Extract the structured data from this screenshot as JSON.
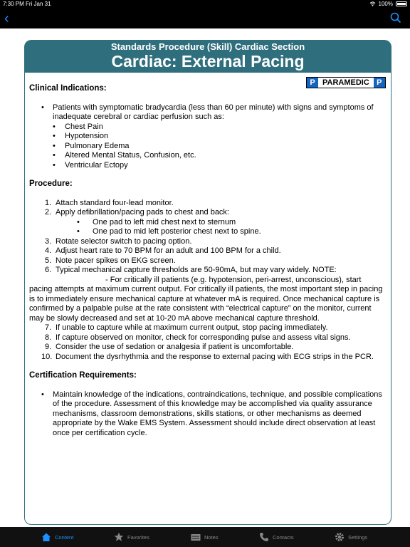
{
  "status": {
    "time": "7:30 PM",
    "date": "Fri Jan 31",
    "battery": "100%"
  },
  "header": {
    "subtitle": "Standards Procedure (Skill) Cardiac Section",
    "title": "Cardiac:  External Pacing"
  },
  "badge": {
    "left": "P",
    "label": "PARAMEDIC",
    "right": "P"
  },
  "clinical": {
    "heading": "Clinical Indications:",
    "main": "Patients with symptomatic bradycardia (less than 60 per minute) with signs and symptoms of inadequate cerebral or cardiac perfusion such as:",
    "items": [
      "Chest Pain",
      "Hypotension",
      "Pulmonary Edema",
      "Altered Mental Status, Confusion, etc.",
      "Ventricular Ectopy"
    ]
  },
  "procedure": {
    "heading": "Procedure:",
    "s1": "Attach standard four-lead monitor.",
    "s2": "Apply defibrillation/pacing pads to chest and back:",
    "s2a": "One pad to left mid chest next to sternum",
    "s2b": "One pad to mid left posterior chest next to spine.",
    "s3": "Rotate selector switch to pacing option.",
    "s4": "Adjust heart rate to 70 BPM for an adult and 100 BPM for a child.",
    "s5": "Note pacer spikes on EKG screen.",
    "s6": "Typical mechanical capture thresholds are 50-90mA, but may vary widely. NOTE:",
    "s6note": "- For critically ill patients (e.g. hypotension, peri-arrest, unconscious), start pacing attempts at maximum current output.  For critically ill patients, the most important step in pacing is to immediately ensure mechanical capture at whatever mA is required. Once mechanical capture is confirmed by a palpable pulse at the rate consistent with “electrical capture” on the monitor, current may be slowly decreased and set at 10-20 mA above mechanical capture threshold.",
    "s7": "If unable to capture while at maximum current output, stop pacing immediately.",
    "s8": "If capture observed on monitor, check for corresponding pulse and assess vital signs.",
    "s9": "Consider the use of sedation or analgesia if patient is uncomfortable.",
    "s10": "Document the dysrhythmia and the response to external pacing with ECG strips in the PCR."
  },
  "certification": {
    "heading": "Certification Requirements:",
    "text": "Maintain knowledge of the indications, contraindications, technique, and possible complications of the procedure.  Assessment of this knowledge may be accomplished via quality assurance mechanisms, classroom demonstrations, skills stations, or other mechanisms as deemed appropriate by the Wake EMS System.  Assessment should include direct observation at least once per certification cycle."
  },
  "tabs": {
    "content": "Content",
    "favorites": "Favorites",
    "notes": "Notes",
    "contacts": "Contacts",
    "settings": "Settings"
  },
  "colors": {
    "accent": "#1e90ff",
    "header": "#2f6e7d",
    "badge": "#1565c0"
  }
}
